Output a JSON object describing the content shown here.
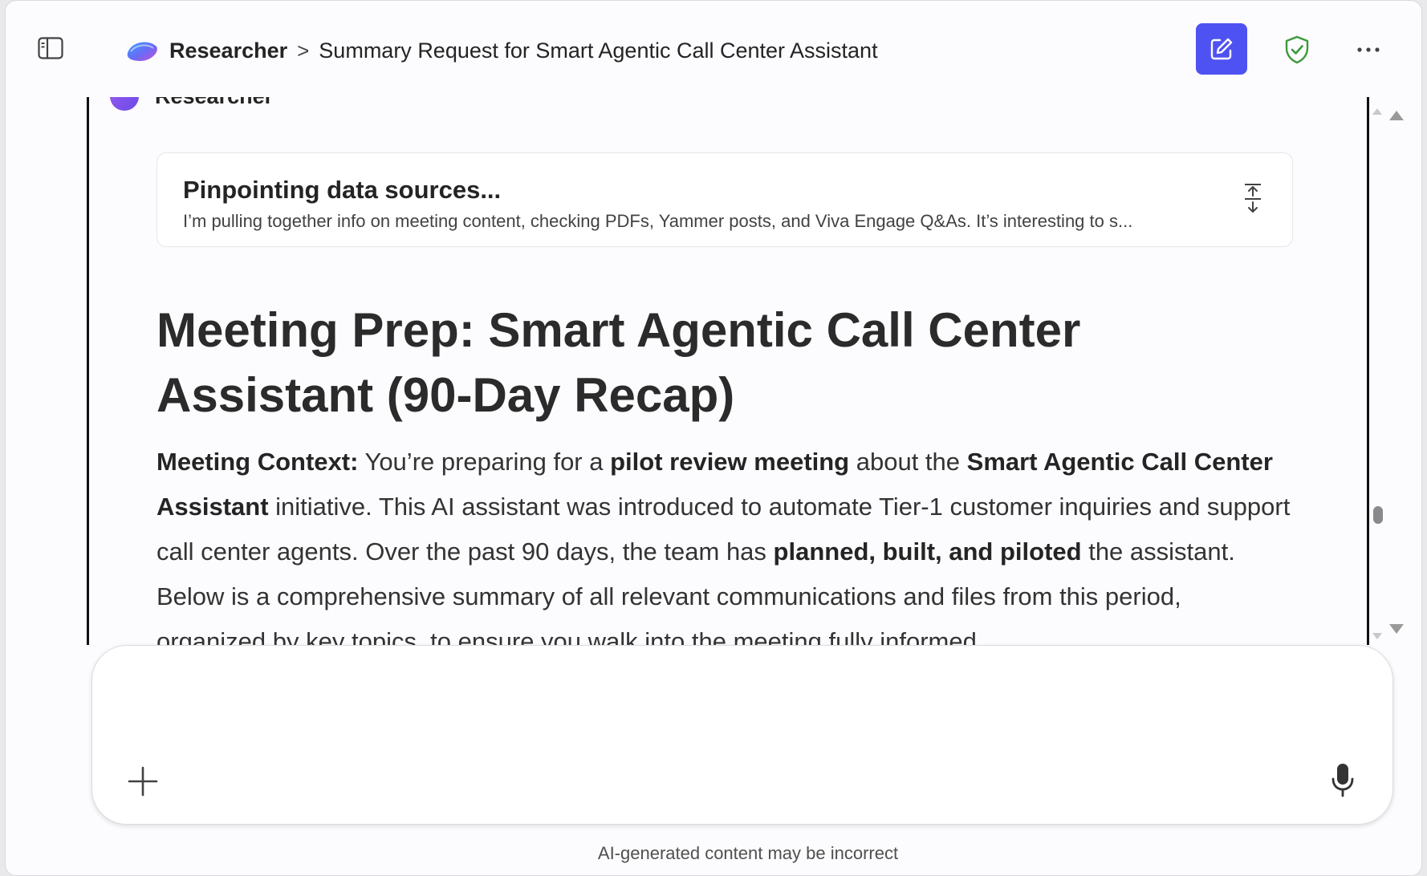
{
  "header": {
    "app_name": "Researcher",
    "separator": ">",
    "conversation_title": "Summary Request for Smart Agentic Call Center Assistant",
    "more_label": "···"
  },
  "agent": {
    "name": "Researcher"
  },
  "status_card": {
    "title": "Pinpointing data sources...",
    "detail": "I’m pulling together info on meeting content, checking PDFs, Yammer posts, and Viva Engage Q&As. It’s interesting to s..."
  },
  "document": {
    "heading": "Meeting Prep: Smart Agentic Call Center Assistant (90-Day Recap)",
    "paragraph": {
      "label": "Meeting Context:",
      "t1": " You’re preparing for a ",
      "b1": "pilot review meeting",
      "t2": " about the ",
      "b2": "Smart Agentic Call Center Assistant",
      "t3": " initiative. This AI assistant was introduced to automate Tier-1 customer inquiries and support call center agents. Over the past 90 days, the team has ",
      "b3": "planned, built, and piloted",
      "t4": " the assistant. Below is a comprehensive summary of all relevant communications and files from this period, organized by key topics, to ensure you walk into the meeting fully informed."
    }
  },
  "composer": {
    "placeholder": ""
  },
  "footer": {
    "disclaimer": "AI-generated content may be incorrect"
  },
  "colors": {
    "accent": "#4f52f2",
    "shield": "#3a9a3a",
    "background": "#fcfbfd"
  }
}
